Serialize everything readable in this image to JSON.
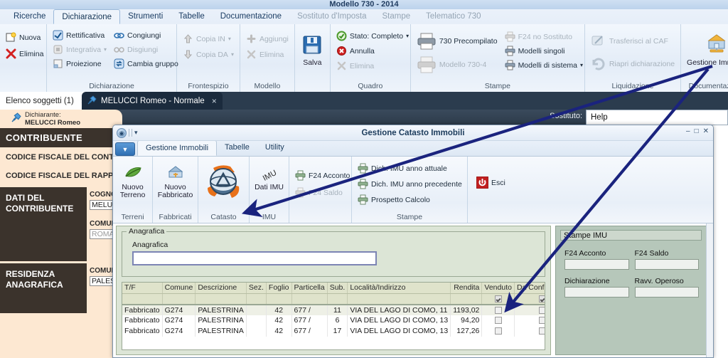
{
  "app": {
    "title": "Modello 730 - 2014"
  },
  "ribbon": {
    "tabs": [
      {
        "label": "Ricerche",
        "state": "normal"
      },
      {
        "label": "Dichiarazione",
        "state": "active"
      },
      {
        "label": "Strumenti",
        "state": "normal"
      },
      {
        "label": "Tabelle",
        "state": "normal"
      },
      {
        "label": "Documentazione",
        "state": "normal"
      },
      {
        "label": "Sostituto d'Imposta",
        "state": "disabled"
      },
      {
        "label": "Stampe",
        "state": "disabled"
      },
      {
        "label": "Telematico 730",
        "state": "disabled"
      }
    ],
    "groups": {
      "g0": {
        "label": "",
        "buttons": [
          {
            "label": "Nuova",
            "icon": "new-document-icon"
          },
          {
            "label": "Elimina",
            "icon": "red-x-icon"
          }
        ]
      },
      "dichiarazione": {
        "label": "Dichiarazione",
        "col1": [
          {
            "label": "Rettificativa",
            "icon": "rectify-icon",
            "disabled": false
          },
          {
            "label": "Integrativa",
            "icon": "integrate-icon",
            "disabled": true,
            "dropdown": true
          },
          {
            "label": "Proiezione",
            "icon": "projection-icon",
            "disabled": false
          }
        ],
        "col2": [
          {
            "label": "Congiungi",
            "icon": "join-icon",
            "disabled": false
          },
          {
            "label": "Disgiungi",
            "icon": "split-icon",
            "disabled": true
          },
          {
            "label": "Cambia gruppo",
            "icon": "change-group-icon",
            "disabled": false
          }
        ]
      },
      "frontespizio": {
        "label": "Frontespizio",
        "items": [
          {
            "label": "Copia IN",
            "icon": "copy-in-icon",
            "disabled": true,
            "dropdown": true
          },
          {
            "label": "Copia DA",
            "icon": "copy-from-icon",
            "disabled": true,
            "dropdown": true
          }
        ]
      },
      "modello": {
        "label": "Modello",
        "items": [
          {
            "label": "Aggiungi",
            "icon": "plus-icon",
            "disabled": true
          },
          {
            "label": "Elimina",
            "icon": "x-icon",
            "disabled": true
          }
        ]
      },
      "salva": {
        "label": "Salva",
        "icon": "floppy-save-icon"
      },
      "quadro": {
        "label": "Quadro",
        "items": [
          {
            "label": "Stato: Completo",
            "icon": "status-ok-icon",
            "disabled": false,
            "dropdown": true
          },
          {
            "label": "Annulla",
            "icon": "cancel-icon",
            "disabled": false
          },
          {
            "label": "Elimina",
            "icon": "x-icon",
            "disabled": true
          }
        ]
      },
      "stampe": {
        "label": "Stampe",
        "big": [
          {
            "label": "730 Precompilato",
            "icon": "printer-icon",
            "disabled": false
          },
          {
            "label": "Modello 730-4",
            "icon": "printer-icon",
            "disabled": true
          }
        ],
        "small": [
          {
            "label": "F24 no Sostituto",
            "icon": "printer-icon",
            "disabled": true
          },
          {
            "label": "Modelli singoli",
            "icon": "printer-icon",
            "disabled": false
          },
          {
            "label": "Modelli di sistema",
            "icon": "printer-icon",
            "disabled": false,
            "dropdown": true
          }
        ]
      },
      "liquidazione": {
        "label": "Liquidazione",
        "items": [
          {
            "label": "Trasferisci al CAF",
            "icon": "transfer-icon",
            "disabled": true
          },
          {
            "label": "Riapri dichiarazione",
            "icon": "reopen-icon",
            "disabled": true
          }
        ]
      },
      "documentazione": {
        "label": "Documentazione",
        "button": {
          "label": "Gestione Immobili",
          "icon": "house-icon"
        }
      }
    }
  },
  "doc_tabs": [
    {
      "label": "Elenco soggetti (1)",
      "active": false,
      "close": "×"
    },
    {
      "label": "MELUCCI Romeo - Normale",
      "active": true,
      "close": "×",
      "icon": "pin-icon"
    }
  ],
  "declarer": {
    "caption": "Dichiarante:",
    "name": "MELUCCI Romeo",
    "icon": "pin-icon"
  },
  "sostituto": {
    "label": "Sostituto:",
    "value": "Help"
  },
  "form": {
    "header1": "CONTRIBUENTE",
    "row1": "CODICE FISCALE DEL CONTRIBUENTE",
    "row2": "CODICE FISCALE DEL RAPPRESENTANTE",
    "band1": {
      "title_l1": "DATI DEL",
      "title_l2": "CONTRIBUENTE",
      "f1_label": "COGNOME",
      "f1_value": "MELUCCI",
      "f2_label": "COMUNE",
      "f2_value": "ROMA"
    },
    "band2": {
      "title_l1": "RESIDENZA",
      "title_l2": "ANAGRAFICA",
      "f1_label": "COMUNE",
      "f1_value": "PALESTRINA"
    }
  },
  "dialog": {
    "title": "Gestione Catasto Immobili",
    "window_buttons": {
      "minimize": "–",
      "maximize": "□",
      "close": "✕"
    },
    "quick_access": {
      "orb": "◉",
      "caret": "▾"
    },
    "tabs": [
      {
        "label": "Gestione Immobili",
        "active": true
      },
      {
        "label": "Tabelle",
        "active": false
      },
      {
        "label": "Utility",
        "active": false
      }
    ],
    "ribbon": {
      "terreni": {
        "label": "Terreni",
        "button": {
          "l1": "Nuovo",
          "l2": "Terreno",
          "icon": "leaf-icon"
        }
      },
      "fabbricati": {
        "label": "Fabbricati",
        "button": {
          "l1": "Nuovo",
          "l2": "Fabbricato",
          "icon": "building-icon"
        }
      },
      "catasto": {
        "label": "Catasto",
        "button": {
          "label": "",
          "icon": "cadastre-globe-icon"
        }
      },
      "imu": {
        "label": "IMU",
        "button": {
          "label": "Dati IMU",
          "badge": "IMU",
          "icon": "imu-icon"
        }
      },
      "f24": {
        "items": [
          {
            "label": "F24 Acconto",
            "icon": "printer-icon",
            "disabled": false
          },
          {
            "label": "F24 Saldo",
            "icon": "printer-icon",
            "disabled": true
          }
        ]
      },
      "stampe": {
        "label": "Stampe",
        "items": [
          {
            "label": "Dich. IMU anno attuale",
            "icon": "printer-icon"
          },
          {
            "label": "Dich. IMU anno precedente",
            "icon": "printer-icon"
          },
          {
            "label": "Prospetto Calcolo",
            "icon": "printer-icon"
          }
        ]
      },
      "esci": {
        "label": "Esci",
        "icon": "power-icon"
      }
    },
    "anagrafica": {
      "legend": "Anagrafica",
      "field_label": "Anagrafica",
      "field_value": "",
      "field_placeholder": ""
    },
    "table": {
      "columns": [
        "T/F",
        "Comune",
        "Descrizione",
        "Sez.",
        "Foglio",
        "Particella",
        "Sub.",
        "Località/Indirizzo",
        "Rendita",
        "Venduto",
        "Da Confermare"
      ],
      "filter_row": {
        "venduto": true,
        "da_confermare": true
      },
      "rows": [
        {
          "tf": "Fabbricato",
          "comune": "G274",
          "descrizione": "PALESTRINA",
          "sez": "",
          "foglio": "42",
          "particella": "677 /",
          "sub": "11",
          "indirizzo": "VIA DEL LAGO DI COMO, 11",
          "rendita": "1193,02",
          "venduto": false,
          "da_confermare": false
        },
        {
          "tf": "Fabbricato",
          "comune": "G274",
          "descrizione": "PALESTRINA",
          "sez": "",
          "foglio": "42",
          "particella": "677 /",
          "sub": "6",
          "indirizzo": "VIA DEL LAGO DI COMO, 13",
          "rendita": "94,20",
          "venduto": false,
          "da_confermare": false
        },
        {
          "tf": "Fabbricato",
          "comune": "G274",
          "descrizione": "PALESTRINA",
          "sez": "",
          "foglio": "42",
          "particella": "677 /",
          "sub": "17",
          "indirizzo": "VIA DEL LAGO DI COMO, 13",
          "rendita": "127,26",
          "venduto": false,
          "da_confermare": false
        }
      ]
    },
    "stampe_imu": {
      "title": "Stampe IMU",
      "fields": [
        {
          "label": "F24 Acconto",
          "value": ""
        },
        {
          "label": "F24 Saldo",
          "value": ""
        },
        {
          "label": "Dichiarazione",
          "value": ""
        },
        {
          "label": "Ravv. Operoso",
          "value": ""
        }
      ]
    }
  },
  "annotations": {
    "arrow_color": "#1a237e",
    "arrows": [
      {
        "name": "arrow-to-catasto",
        "from": [
          1000,
          95
        ],
        "to": [
          338,
          300
        ]
      },
      {
        "name": "arrow-to-da-confermare",
        "from": [
          995,
          100
        ],
        "to": [
          710,
          432
        ]
      }
    ]
  }
}
